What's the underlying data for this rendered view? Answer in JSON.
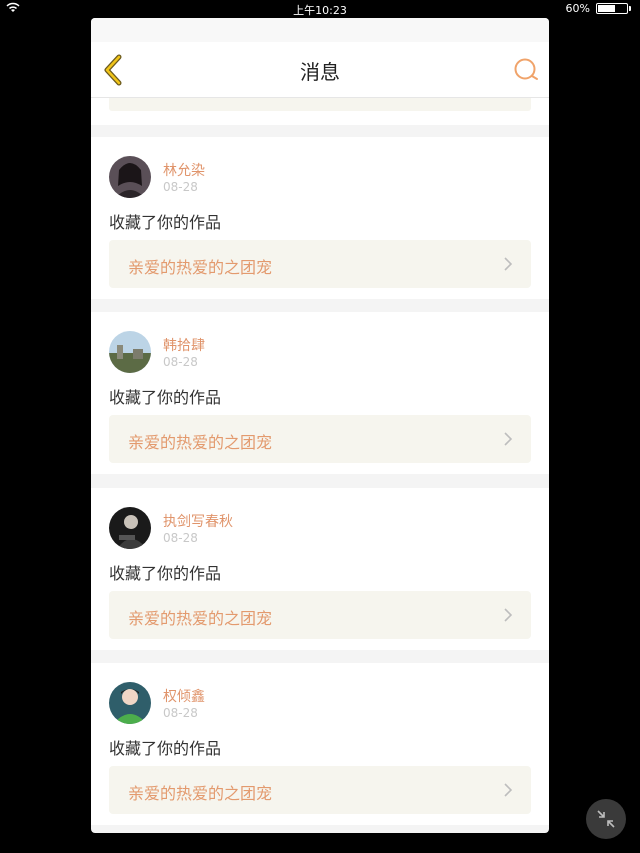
{
  "status_bar": {
    "time": "上午10:23",
    "battery": "60%"
  },
  "header": {
    "title": "消息"
  },
  "colors": {
    "accent": "#e39a6e",
    "back_icon": "#e7b400"
  },
  "messages": [
    {
      "user": "林允染",
      "date": "08-28",
      "action": "收藏了你的作品",
      "work": "亲爱的热爱的之团宠"
    },
    {
      "user": "韩拾肆",
      "date": "08-28",
      "action": "收藏了你的作品",
      "work": "亲爱的热爱的之团宠"
    },
    {
      "user": "执剑写春秋",
      "date": "08-28",
      "action": "收藏了你的作品",
      "work": "亲爱的热爱的之团宠"
    },
    {
      "user": "权倾鑫",
      "date": "08-28",
      "action": "收藏了你的作品",
      "work": "亲爱的热爱的之团宠"
    }
  ]
}
